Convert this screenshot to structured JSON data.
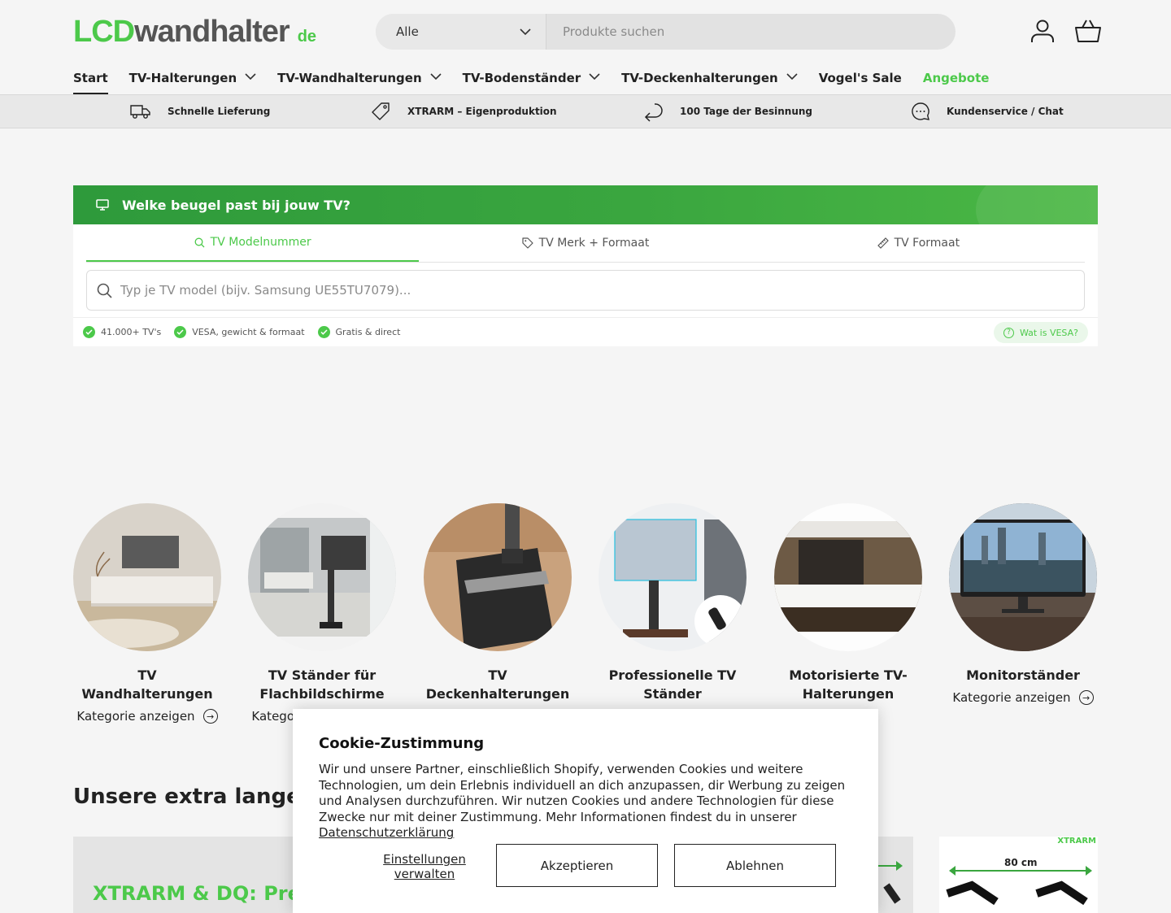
{
  "header": {
    "logo_lcd": "LCD",
    "logo_wand": "wandhalter",
    "logo_de": "de",
    "search": {
      "category": "Alle",
      "placeholder": "Produkte suchen"
    },
    "account_icon": "user-icon",
    "cart_icon": "basket-icon"
  },
  "nav": {
    "items": [
      {
        "label": "Start"
      },
      {
        "label": "TV-Halterungen"
      },
      {
        "label": "TV-Wandhalterungen"
      },
      {
        "label": "TV-Bodenständer"
      },
      {
        "label": "TV-Deckenhalterungen"
      },
      {
        "label": "Vogel's Sale"
      },
      {
        "label": "Angebote"
      }
    ]
  },
  "usps": [
    {
      "label": "Schnelle Lieferung",
      "icon": "truck-icon"
    },
    {
      "label": "XTRARM – Eigenproduktion",
      "icon": "tag-icon"
    },
    {
      "label": "100 Tage der Besinnung",
      "icon": "return-arrow-icon"
    },
    {
      "label": "Kundenservice / Chat",
      "icon": "chat-icon"
    }
  ],
  "finder": {
    "title": "Welke beugel past bij jouw TV?",
    "tabs": [
      {
        "label": "TV Modelnummer",
        "icon": "search-icon"
      },
      {
        "label": "TV Merk + Formaat",
        "icon": "tag-icon"
      },
      {
        "label": "TV Formaat",
        "icon": "ruler-icon"
      }
    ],
    "input_placeholder": "Typ je TV model (bijv. Samsung UE55TU7079)...",
    "checks": [
      "41.000+ TV's",
      "VESA, gewicht & formaat",
      "Gratis & direct"
    ],
    "vesa_link": "Wat is VESA?"
  },
  "categories": {
    "link_label": "Kategorie anzeigen",
    "items": [
      {
        "title": "TV Wandhalterungen"
      },
      {
        "title": "TV Ständer für Flachbildschirme"
      },
      {
        "title": "TV Deckenhalterungen"
      },
      {
        "title": "Professionelle TV Ständer"
      },
      {
        "title": "Motorisierte TV-Halterungen"
      },
      {
        "title": "Monitorständer"
      }
    ]
  },
  "section_title": "Unsere extra langen TV",
  "promo": {
    "headline": "XTRARM & DQ: Premi",
    "card_brand": "XTRARM",
    "card_dimension": "80 cm"
  },
  "cookie": {
    "title": "Cookie-Zustimmung",
    "body": "Wir und unsere Partner, einschließlich Shopify, verwenden Cookies und weitere Technologien, um dein Erlebnis individuell an dich anzupassen, dir Werbung zu zeigen und Analysen durchzuführen. Wir nutzen Cookies und andere Technologien für diese Zwecke nur mit deiner Zustimmung. Mehr Informationen findest du in unserer ",
    "privacy_link": "Datenschutzerklärung",
    "manage_label": "Einstellungen verwalten",
    "accept_label": "Akzeptieren",
    "decline_label": "Ablehnen"
  },
  "colors": {
    "brand_green": "#4cc94a",
    "finder_green": "#3aa63f",
    "text": "#222222"
  }
}
